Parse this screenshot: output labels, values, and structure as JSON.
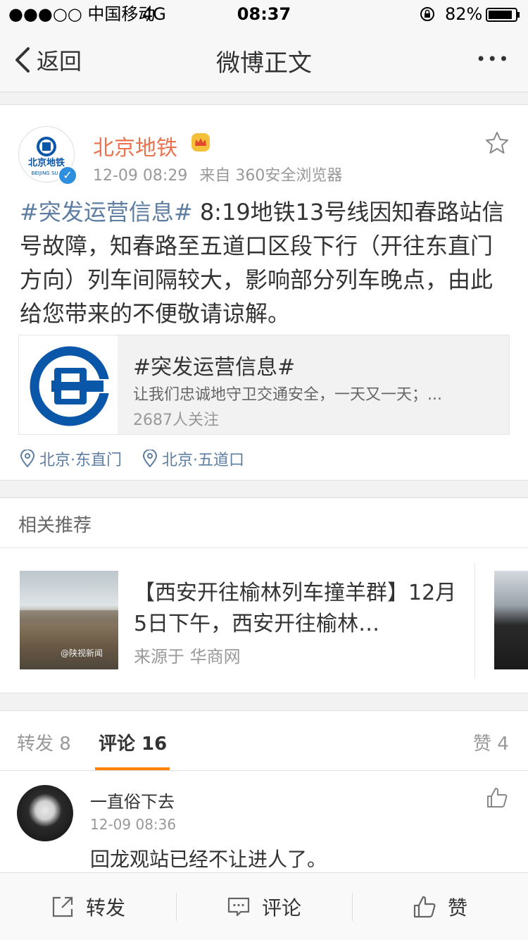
{
  "status": {
    "carrier": "●●●○○ 中国移动",
    "network": "4G",
    "time": "08:37",
    "battery": "82%"
  },
  "nav": {
    "back": "返回",
    "title": "微博正文",
    "more": "•••"
  },
  "post": {
    "author": "北京地铁",
    "time": "12-09 08:29",
    "source": "来自 360安全浏览器",
    "topic": "#突发运营信息#",
    "text": " 8:19地铁13号线因知春路站信号故障，知春路至五道口区段下行（开往东直门方向）列车间隔较大，影响部分列车晚点，由此给您带来的不便敬请谅解。",
    "avatar_text_cn": "北京地铁",
    "avatar_text_en": "BEIJING SUB"
  },
  "topic_card": {
    "title": "#突发运营信息#",
    "desc": "让我们忠诚地守卫交通安全，一天又一天；...",
    "followers": "2687人关注"
  },
  "locations": [
    "北京·东直门",
    "北京·五道口"
  ],
  "related": {
    "label": "相关推荐",
    "items": [
      {
        "text": "【西安开往榆林列车撞羊群】12月5日下午，西安开往榆林…",
        "source": "来源于 华商网",
        "thumb_watermark": "@陕视新闻"
      }
    ]
  },
  "tabs": {
    "repost": "转发 8",
    "comment": "评论 16",
    "like": "赞 4"
  },
  "comments": [
    {
      "user": "一直俗下去",
      "time": "12-09 08:36",
      "text": "回龙观站已经不让进人了。"
    }
  ],
  "toolbar": {
    "repost": "转发",
    "comment": "评论",
    "like": "赞"
  },
  "colors": {
    "accent": "#eb7350",
    "link": "#5d7ea2",
    "brand_blue": "#0a56a8"
  }
}
